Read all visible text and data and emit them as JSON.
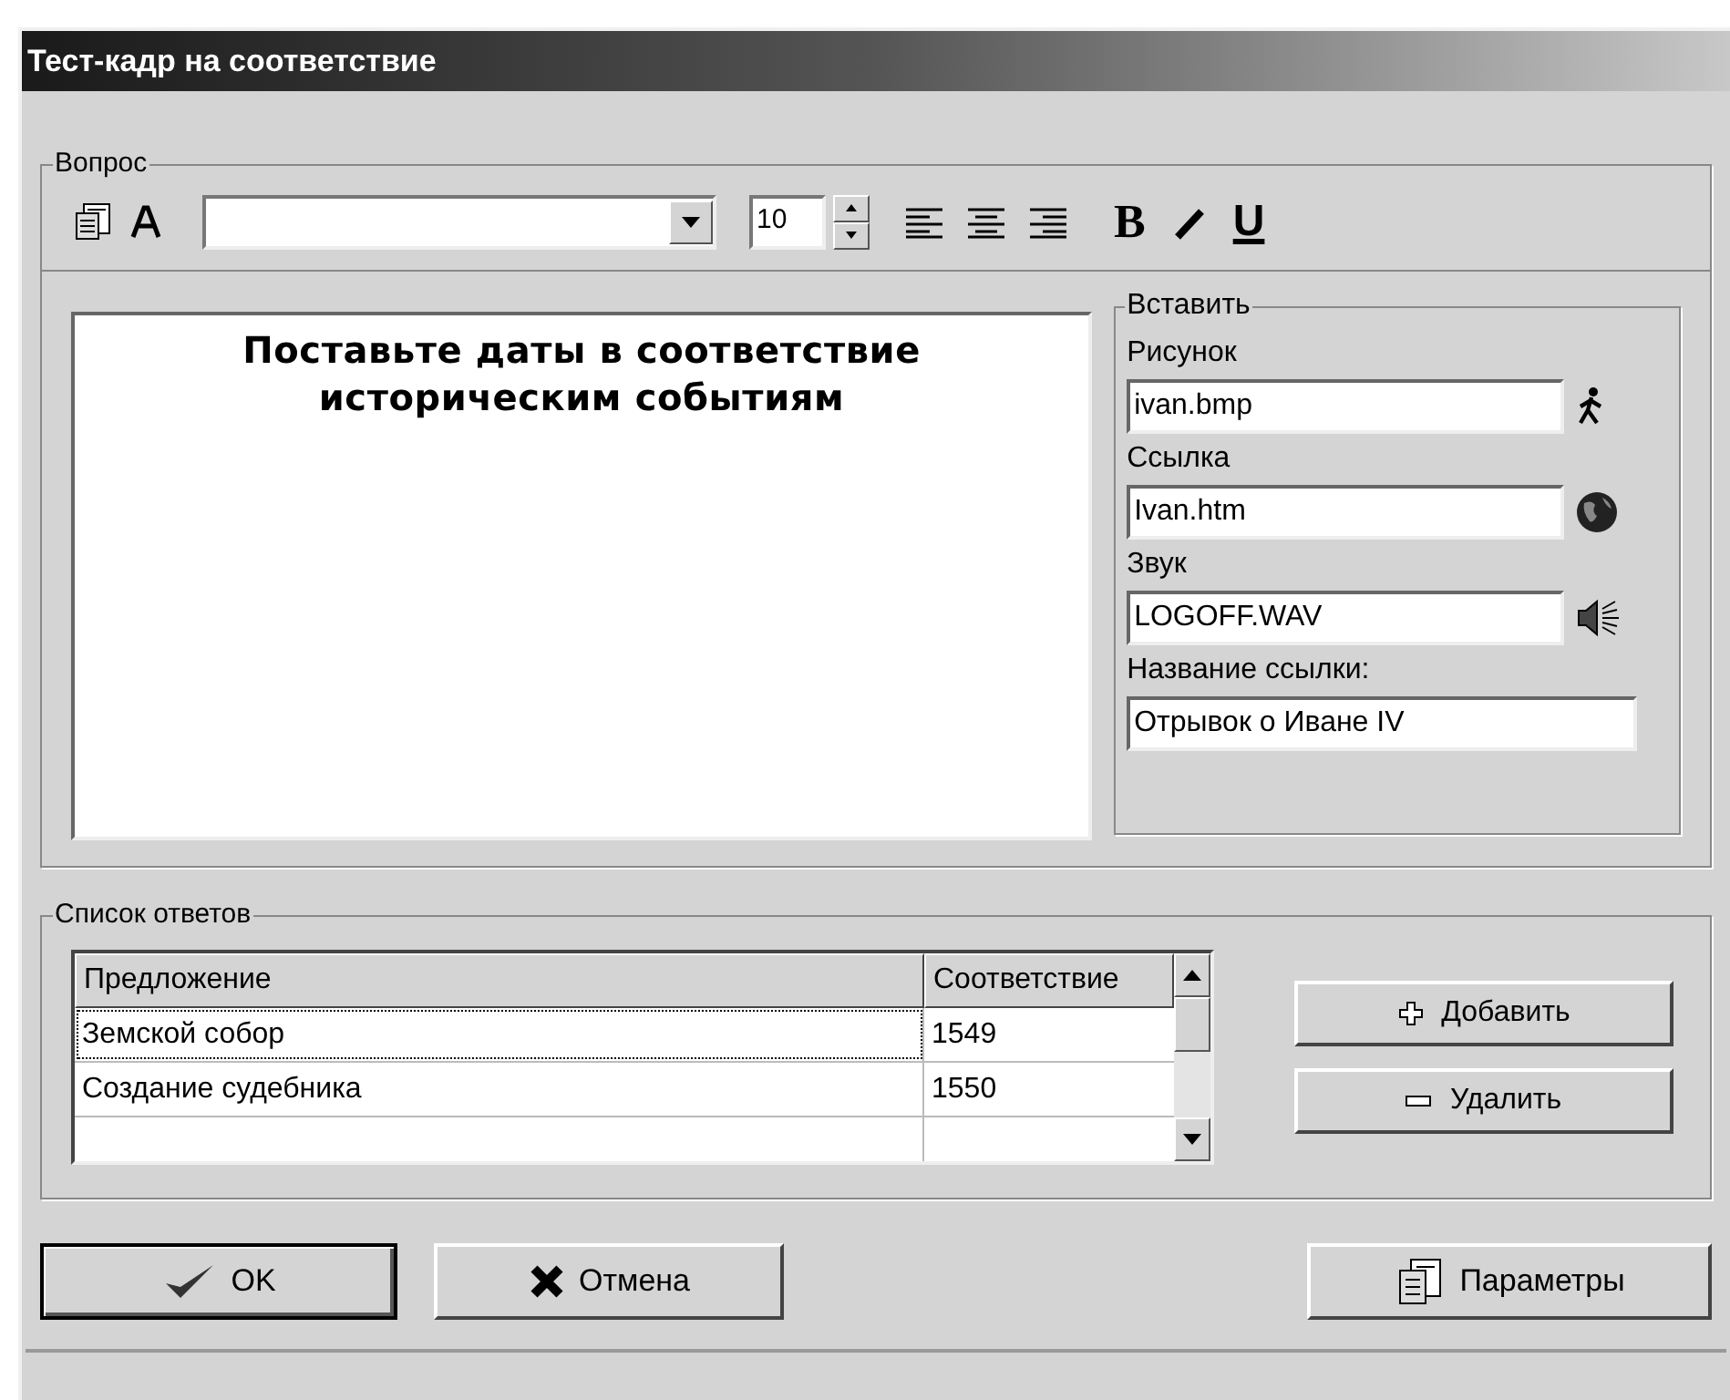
{
  "window": {
    "title": "Тест-кадр на соответствие"
  },
  "question": {
    "legend": "Вопрос",
    "toolbar": {
      "font_size": "10",
      "bold_label": "B",
      "underline_label": "U"
    },
    "text": "Поставьте даты в соответствие историческим событиям",
    "insert": {
      "legend": "Вставить",
      "fields": [
        {
          "kind": "picture",
          "label": "Рисунок",
          "value": "ivan.bmp"
        },
        {
          "kind": "link",
          "label": "Ссылка",
          "value": "Ivan.htm"
        },
        {
          "kind": "sound",
          "label": "Звук",
          "value": "LOGOFF.WAV"
        },
        {
          "kind": "plain",
          "label": "Название ссылки:",
          "value": "Отрывок о Иване IV"
        }
      ]
    }
  },
  "answers": {
    "legend": "Список ответов",
    "columns": [
      "Предложение",
      "Соответствие"
    ],
    "rows": [
      {
        "cells": [
          "Земской собор",
          "1549"
        ],
        "selected": true
      },
      {
        "cells": [
          "Создание судебника",
          "1550"
        ],
        "selected": false
      }
    ],
    "buttons": [
      {
        "kind": "add",
        "label": "Добавить"
      },
      {
        "kind": "remove",
        "label": "Удалить"
      }
    ]
  },
  "buttons": [
    {
      "kind": "ok",
      "label": "OK"
    },
    {
      "kind": "cancel",
      "label": "Отмена"
    },
    {
      "kind": "params",
      "label": "Параметры"
    }
  ]
}
